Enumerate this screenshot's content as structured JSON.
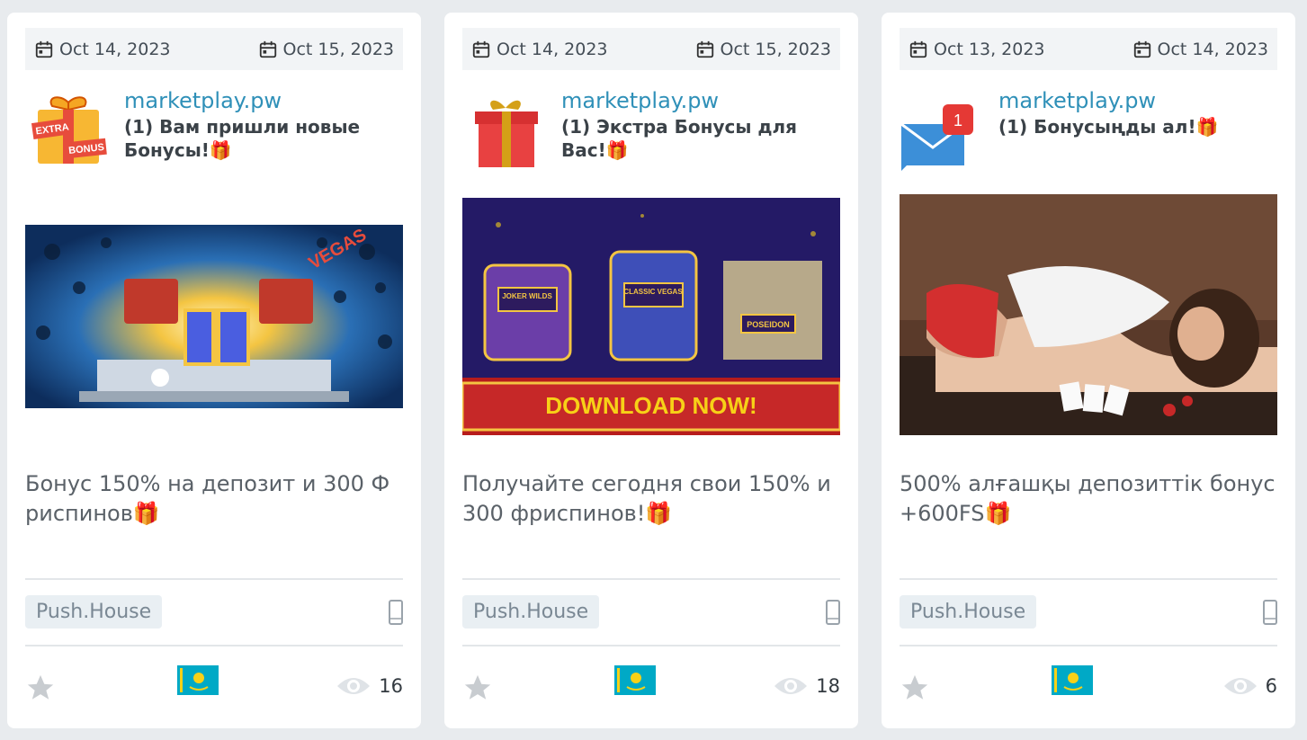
{
  "cards": [
    {
      "start_date": "Oct 14, 2023",
      "end_date": "Oct 15, 2023",
      "domain": "marketplay.pw",
      "title": "(1) Вам пришли новые Бонусы!🎁",
      "icon": "extra-bonus-gift-icon",
      "icon_text_top": "EXTRA",
      "icon_text_bottom": "BONUS",
      "banner": "casino-laptop-gift-banner",
      "banner_text": "VEGAS",
      "description": "Бонус 150% на депозит и 300 Фриспинов🎁",
      "source": "Push.House",
      "device": "mobile-phone-icon",
      "country": "kazakhstan-flag",
      "views": "16"
    },
    {
      "start_date": "Oct 14, 2023",
      "end_date": "Oct 15, 2023",
      "domain": "marketplay.pw",
      "title": "(1) Экстра Бонусы для Вас!🎁",
      "icon": "red-gift-box-icon",
      "banner": "slot-machines-download-banner",
      "banner_slot_1": "JOKER WILDS",
      "banner_slot_2": "CLASSIC VEGAS",
      "banner_slot_3": "POSEIDON",
      "banner_cta": "DOWNLOAD NOW!",
      "description": "Получайте сегодня свои 150% и 300 фриспинов!🎁",
      "source": "Push.House",
      "device": "mobile-phone-icon",
      "country": "kazakhstan-flag",
      "views": "18"
    },
    {
      "start_date": "Oct 13, 2023",
      "end_date": "Oct 14, 2023",
      "domain": "marketplay.pw",
      "title": "(1) Бонусыңды ал!🎁",
      "icon": "mail-envelope-notification-icon",
      "icon_badge": "1",
      "banner": "woman-poker-table-banner",
      "description": "500% алғашқы депозиттік бонус+600FS🎁",
      "source": "Push.House",
      "device": "mobile-phone-icon",
      "country": "kazakhstan-flag",
      "views": "6"
    }
  ],
  "colors": {
    "domain": "#2f90b8",
    "page_bg": "#e8ebee",
    "card_bg": "#ffffff",
    "tag_bg": "#e9eff3"
  }
}
